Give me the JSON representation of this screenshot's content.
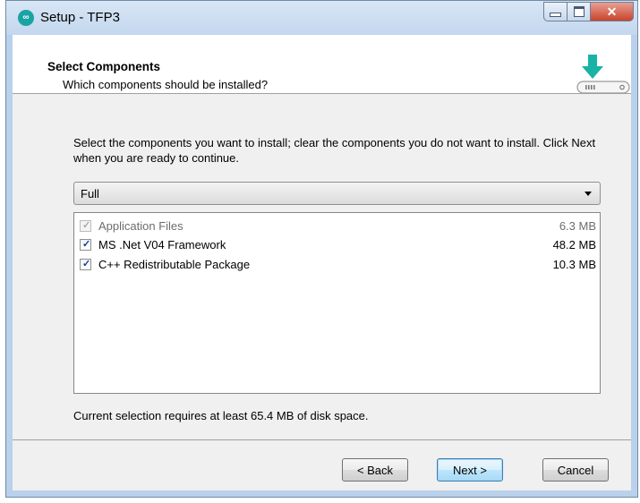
{
  "window": {
    "title": "Setup - TFP3",
    "app_icon_glyph": "∞",
    "close_glyph": "✕"
  },
  "header": {
    "heading": "Select Components",
    "subtitle": "Which components should be installed?"
  },
  "body": {
    "description": "Select the components you want to install; clear the components you do not want to install. Click Next when you are ready to continue.",
    "setup_type": "Full",
    "components": [
      {
        "name": "Application Files",
        "size": "6.3 MB",
        "checked": true,
        "enabled": false
      },
      {
        "name": "MS .Net V04 Framework",
        "size": "48.2 MB",
        "checked": true,
        "enabled": true
      },
      {
        "name": "C++ Redistributable Package",
        "size": "10.3 MB",
        "checked": true,
        "enabled": true
      }
    ],
    "space_note": "Current selection requires at least 65.4 MB of disk space."
  },
  "buttons": {
    "back": "< Back",
    "next": "Next >",
    "cancel": "Cancel"
  },
  "icons": [
    "app-logo-icon",
    "minimize-icon",
    "maximize-icon",
    "close-icon",
    "download-drive-icon",
    "dropdown-arrow-icon",
    "checkbox-icon"
  ],
  "colors": {
    "accent": "#1aa3a3",
    "title_bar": "#c3d7ee",
    "close_button": "#c9442c",
    "default_button_border": "#3c7fb1"
  }
}
